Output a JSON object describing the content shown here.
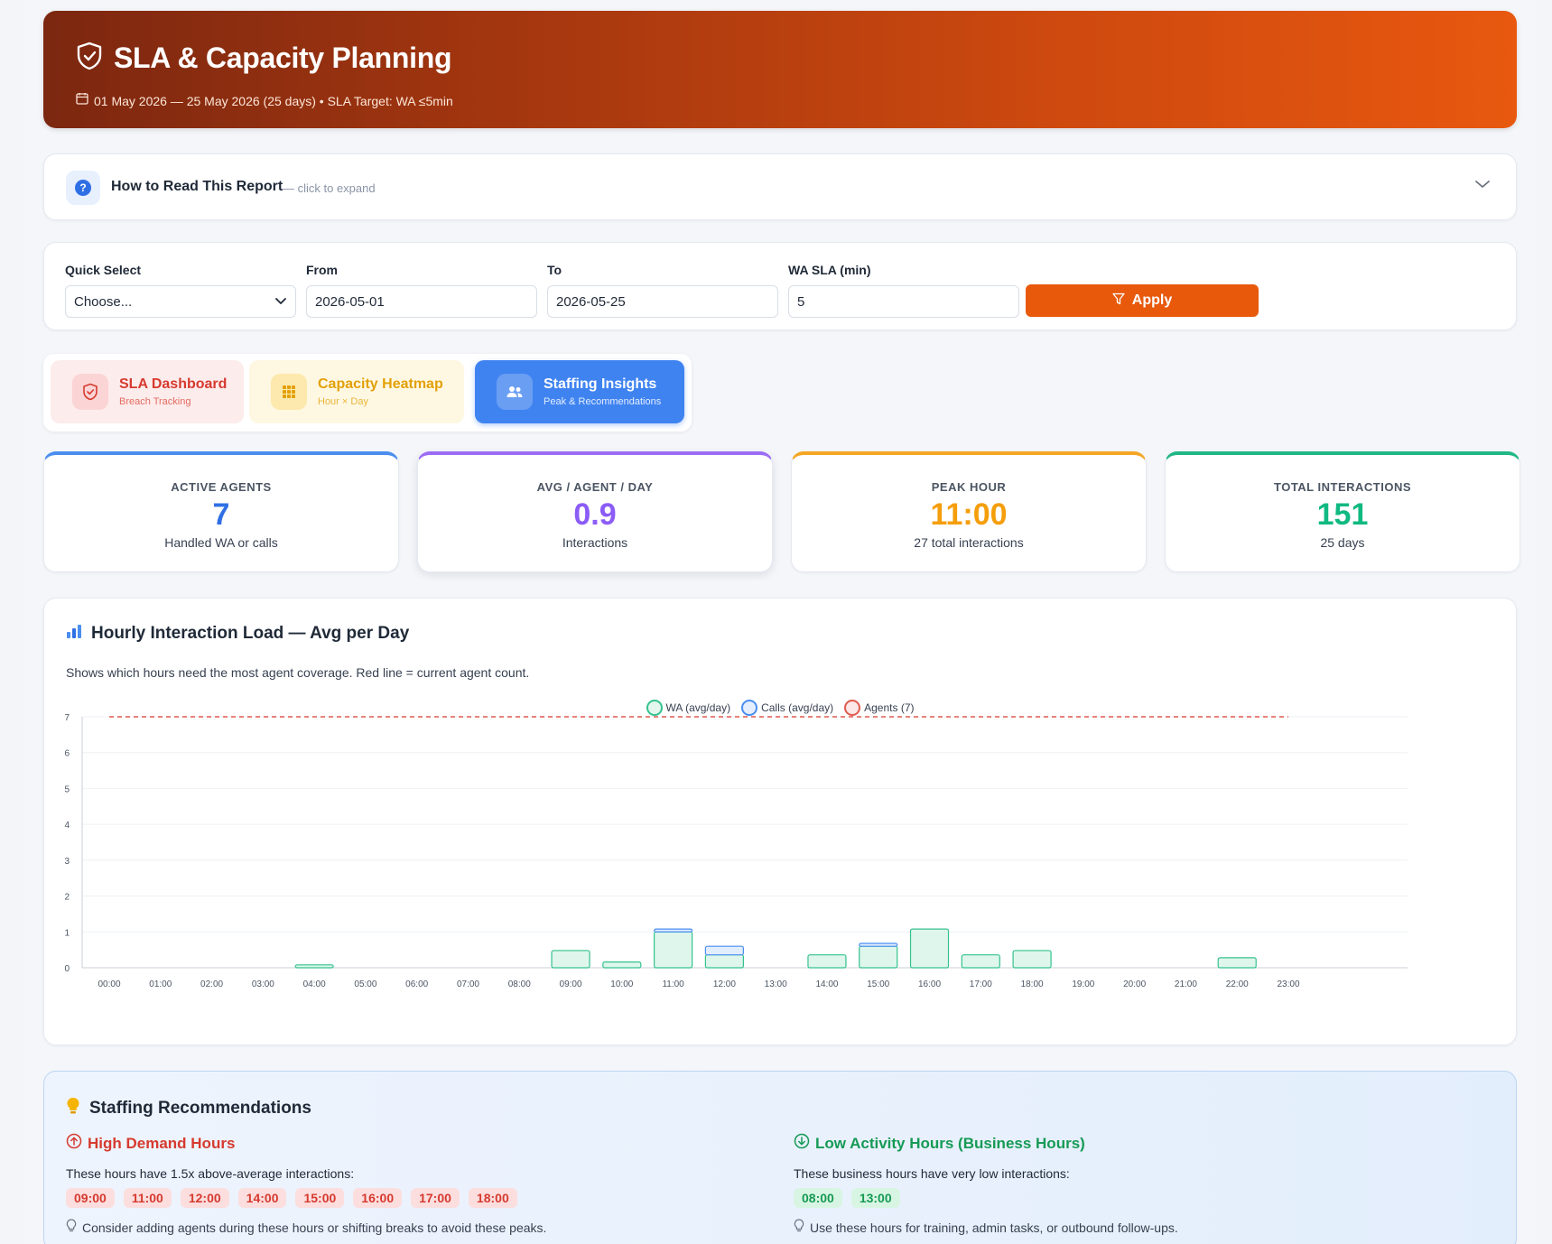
{
  "header": {
    "title": "SLA & Capacity Planning",
    "subtitle": "01 May 2026 — 25 May 2026 (25 days) • SLA Target: WA ≤5min"
  },
  "howto": {
    "label": "How to Read This Report",
    "hint": "— click to expand"
  },
  "filters": {
    "quick_select_label": "Quick Select",
    "quick_select_value": "Choose...",
    "from_label": "From",
    "from_value": "2026-05-01",
    "to_label": "To",
    "to_value": "2026-05-25",
    "sla_label": "WA SLA (min)",
    "sla_value": "5",
    "apply_label": "Apply"
  },
  "tabs": [
    {
      "name": "SLA Dashboard",
      "sub": "Breach Tracking"
    },
    {
      "name": "Capacity Heatmap",
      "sub": "Hour × Day"
    },
    {
      "name": "Staffing Insights",
      "sub": "Peak & Recommendations"
    }
  ],
  "kpis": [
    {
      "label": "ACTIVE AGENTS",
      "value": "7",
      "sub": "Handled WA or calls",
      "color": "#2f6fe4"
    },
    {
      "label": "AVG / AGENT / DAY",
      "value": "0.9",
      "sub": "Interactions",
      "color": "#8b5cf6"
    },
    {
      "label": "PEAK HOUR",
      "value": "11:00",
      "sub": "27 total interactions",
      "color": "#f59e0b"
    },
    {
      "label": "TOTAL INTERACTIONS",
      "value": "151",
      "sub": "25 days",
      "color": "#10b981"
    }
  ],
  "chart": {
    "title": "Hourly Interaction Load — Avg per Day",
    "description": "Shows which hours need the most agent coverage. Red line = current agent count.",
    "legend": [
      "WA (avg/day)",
      "Calls (avg/day)",
      "Agents (7)"
    ]
  },
  "chart_data": {
    "type": "bar",
    "stacked": true,
    "categories": [
      "00:00",
      "01:00",
      "02:00",
      "03:00",
      "04:00",
      "05:00",
      "06:00",
      "07:00",
      "08:00",
      "09:00",
      "10:00",
      "11:00",
      "12:00",
      "13:00",
      "14:00",
      "15:00",
      "16:00",
      "17:00",
      "18:00",
      "19:00",
      "20:00",
      "21:00",
      "22:00",
      "23:00"
    ],
    "series": [
      {
        "name": "WA (avg/day)",
        "values": [
          0,
          0,
          0,
          0,
          0.08,
          0,
          0,
          0,
          0,
          0.48,
          0.16,
          1.0,
          0.36,
          0,
          0.36,
          0.6,
          1.08,
          0.36,
          0.48,
          0,
          0,
          0,
          0.28,
          0
        ]
      },
      {
        "name": "Calls (avg/day)",
        "values": [
          0,
          0,
          0,
          0,
          0,
          0,
          0,
          0,
          0,
          0,
          0,
          0.08,
          0.24,
          0,
          0,
          0.08,
          0,
          0,
          0,
          0,
          0,
          0,
          0,
          0
        ]
      }
    ],
    "agents_line": 7,
    "ylim": [
      0,
      7
    ],
    "yticks": [
      0,
      1,
      2,
      3,
      4,
      5,
      6,
      7
    ],
    "colors": {
      "wa": "#34c28e",
      "calls": "#4a8ef0",
      "agents": "#e05a4f"
    },
    "grid": true,
    "legend_position": "top"
  },
  "recommendations": {
    "title": "Staffing Recommendations",
    "high": {
      "title": "High Demand Hours",
      "text": "These hours have 1.5x above-average interactions:",
      "hours": [
        "09:00",
        "11:00",
        "12:00",
        "14:00",
        "15:00",
        "16:00",
        "17:00",
        "18:00"
      ],
      "tip": "Consider adding agents during these hours or shifting breaks to avoid these peaks."
    },
    "low": {
      "title": "Low Activity Hours (Business Hours)",
      "text": "These business hours have very low interactions:",
      "hours": [
        "08:00",
        "13:00"
      ],
      "tip": "Use these hours for training, admin tasks, or outbound follow-ups."
    }
  }
}
